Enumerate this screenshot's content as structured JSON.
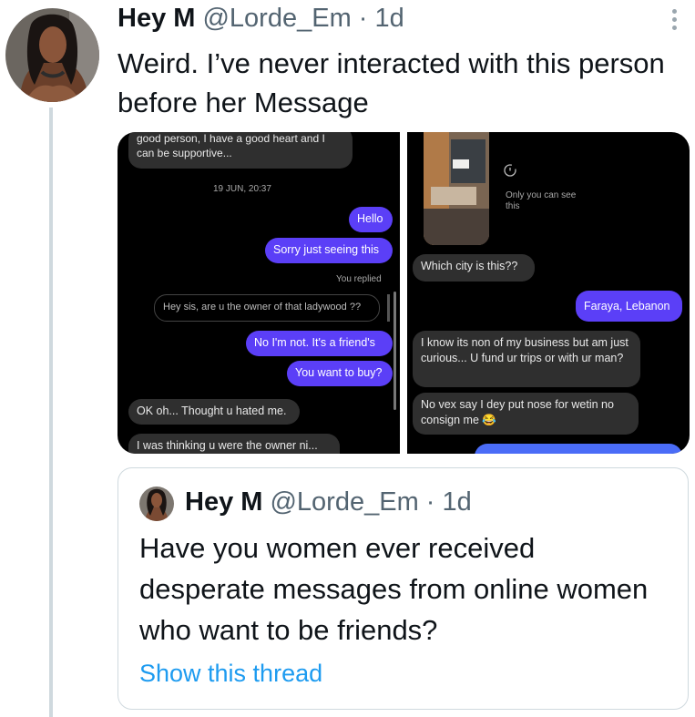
{
  "tweet": {
    "display_name": "Hey M",
    "handle": "@Lorde_Em",
    "separator": "·",
    "time": "1d",
    "text": "Weird. I’ve never interacted with this person before her Message"
  },
  "screenshot_left": {
    "messages": [
      {
        "side": "in",
        "text": "good person, I have a good heart and I can be supportive..."
      },
      {
        "side": "system",
        "text": "19 JUN, 20:37"
      },
      {
        "side": "out",
        "text": "Hello"
      },
      {
        "side": "out",
        "text": "Sorry just seeing this"
      },
      {
        "side": "system",
        "text": "You replied"
      },
      {
        "side": "reply",
        "text": "Hey sis, are u the owner of that ladywood ??"
      },
      {
        "side": "out",
        "text": "No I'm not. It's a friend's"
      },
      {
        "side": "out",
        "text": "You want to buy?"
      },
      {
        "side": "in",
        "text": "OK oh... Thought u hated me."
      },
      {
        "side": "in",
        "text": "I was thinking u were the owner ni..."
      }
    ]
  },
  "screenshot_right": {
    "view_once_label": "Only you can see this",
    "messages": [
      {
        "side": "in",
        "text": "Which city is this??"
      },
      {
        "side": "out",
        "text": "Faraya, Lebanon"
      },
      {
        "side": "in",
        "text": "I know its non of my business but am just curious... U fund ur trips or with ur man?"
      },
      {
        "side": "in",
        "text": "No vex say I dey put nose for wetin no consign me 😂"
      }
    ]
  },
  "quoted_tweet": {
    "display_name": "Hey M",
    "handle": "@Lorde_Em",
    "separator": "·",
    "time": "1d",
    "text": "Have you women ever received desperate messages from online women who want to be friends?",
    "show_thread": "Show this thread"
  },
  "colors": {
    "link": "#1d9bf0",
    "meta": "#536471",
    "bubble_out": "#5b3ff7",
    "bubble_in": "#2f2f2f"
  }
}
